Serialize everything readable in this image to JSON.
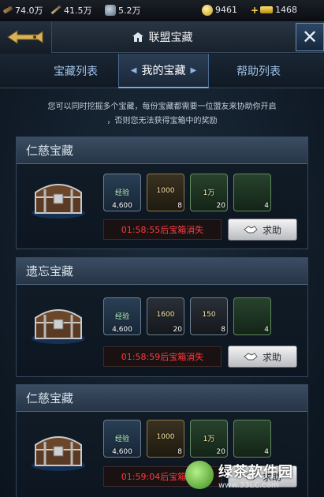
{
  "resources": {
    "wood": "74.0万",
    "weapon": "41.5万",
    "ore": "5.2万",
    "coin": "9461",
    "gold": "1468"
  },
  "header": {
    "title": "联盟宝藏",
    "close_label": "✕"
  },
  "tabs": {
    "list": "宝藏列表",
    "mine": "我的宝藏",
    "help": "帮助列表"
  },
  "notice": {
    "line1": "您可以同时挖掘多个宝藏，每份宝藏都需要一位盟友来协助你开启",
    "line2": "，否则您无法获得宝箱中的奖励"
  },
  "treasures": [
    {
      "name": "仁慈宝藏",
      "items": [
        {
          "type": "blue",
          "label": "经验",
          "count": "4,600"
        },
        {
          "type": "gold",
          "label": "1000",
          "count": "8"
        },
        {
          "type": "green",
          "label": "1万",
          "count": "20"
        },
        {
          "type": "green",
          "label": "",
          "count": "4"
        }
      ],
      "timer": "01:58:55后宝箱消失",
      "help_label": "求助"
    },
    {
      "name": "遗忘宝藏",
      "items": [
        {
          "type": "blue",
          "label": "经验",
          "count": "4,600"
        },
        {
          "type": "dark",
          "label": "1600",
          "count": "20"
        },
        {
          "type": "dark",
          "label": "150",
          "count": "8"
        },
        {
          "type": "green",
          "label": "",
          "count": "4"
        }
      ],
      "timer": "01:58:59后宝箱消失",
      "help_label": "求助"
    },
    {
      "name": "仁慈宝藏",
      "items": [
        {
          "type": "blue",
          "label": "经验",
          "count": "4,600"
        },
        {
          "type": "gold",
          "label": "1000",
          "count": "8"
        },
        {
          "type": "green",
          "label": "1万",
          "count": "20"
        },
        {
          "type": "green",
          "label": "",
          "count": "4"
        }
      ],
      "timer": "01:59:04后宝箱消失",
      "help_label": "求助"
    }
  ],
  "watermark": {
    "main": "绿茶软件园",
    "sub": "www.33LC.com"
  },
  "colors": {
    "timer": "#ff3c3c",
    "tab_active": "#ffffff",
    "tab_inactive": "#9fc2e8"
  }
}
